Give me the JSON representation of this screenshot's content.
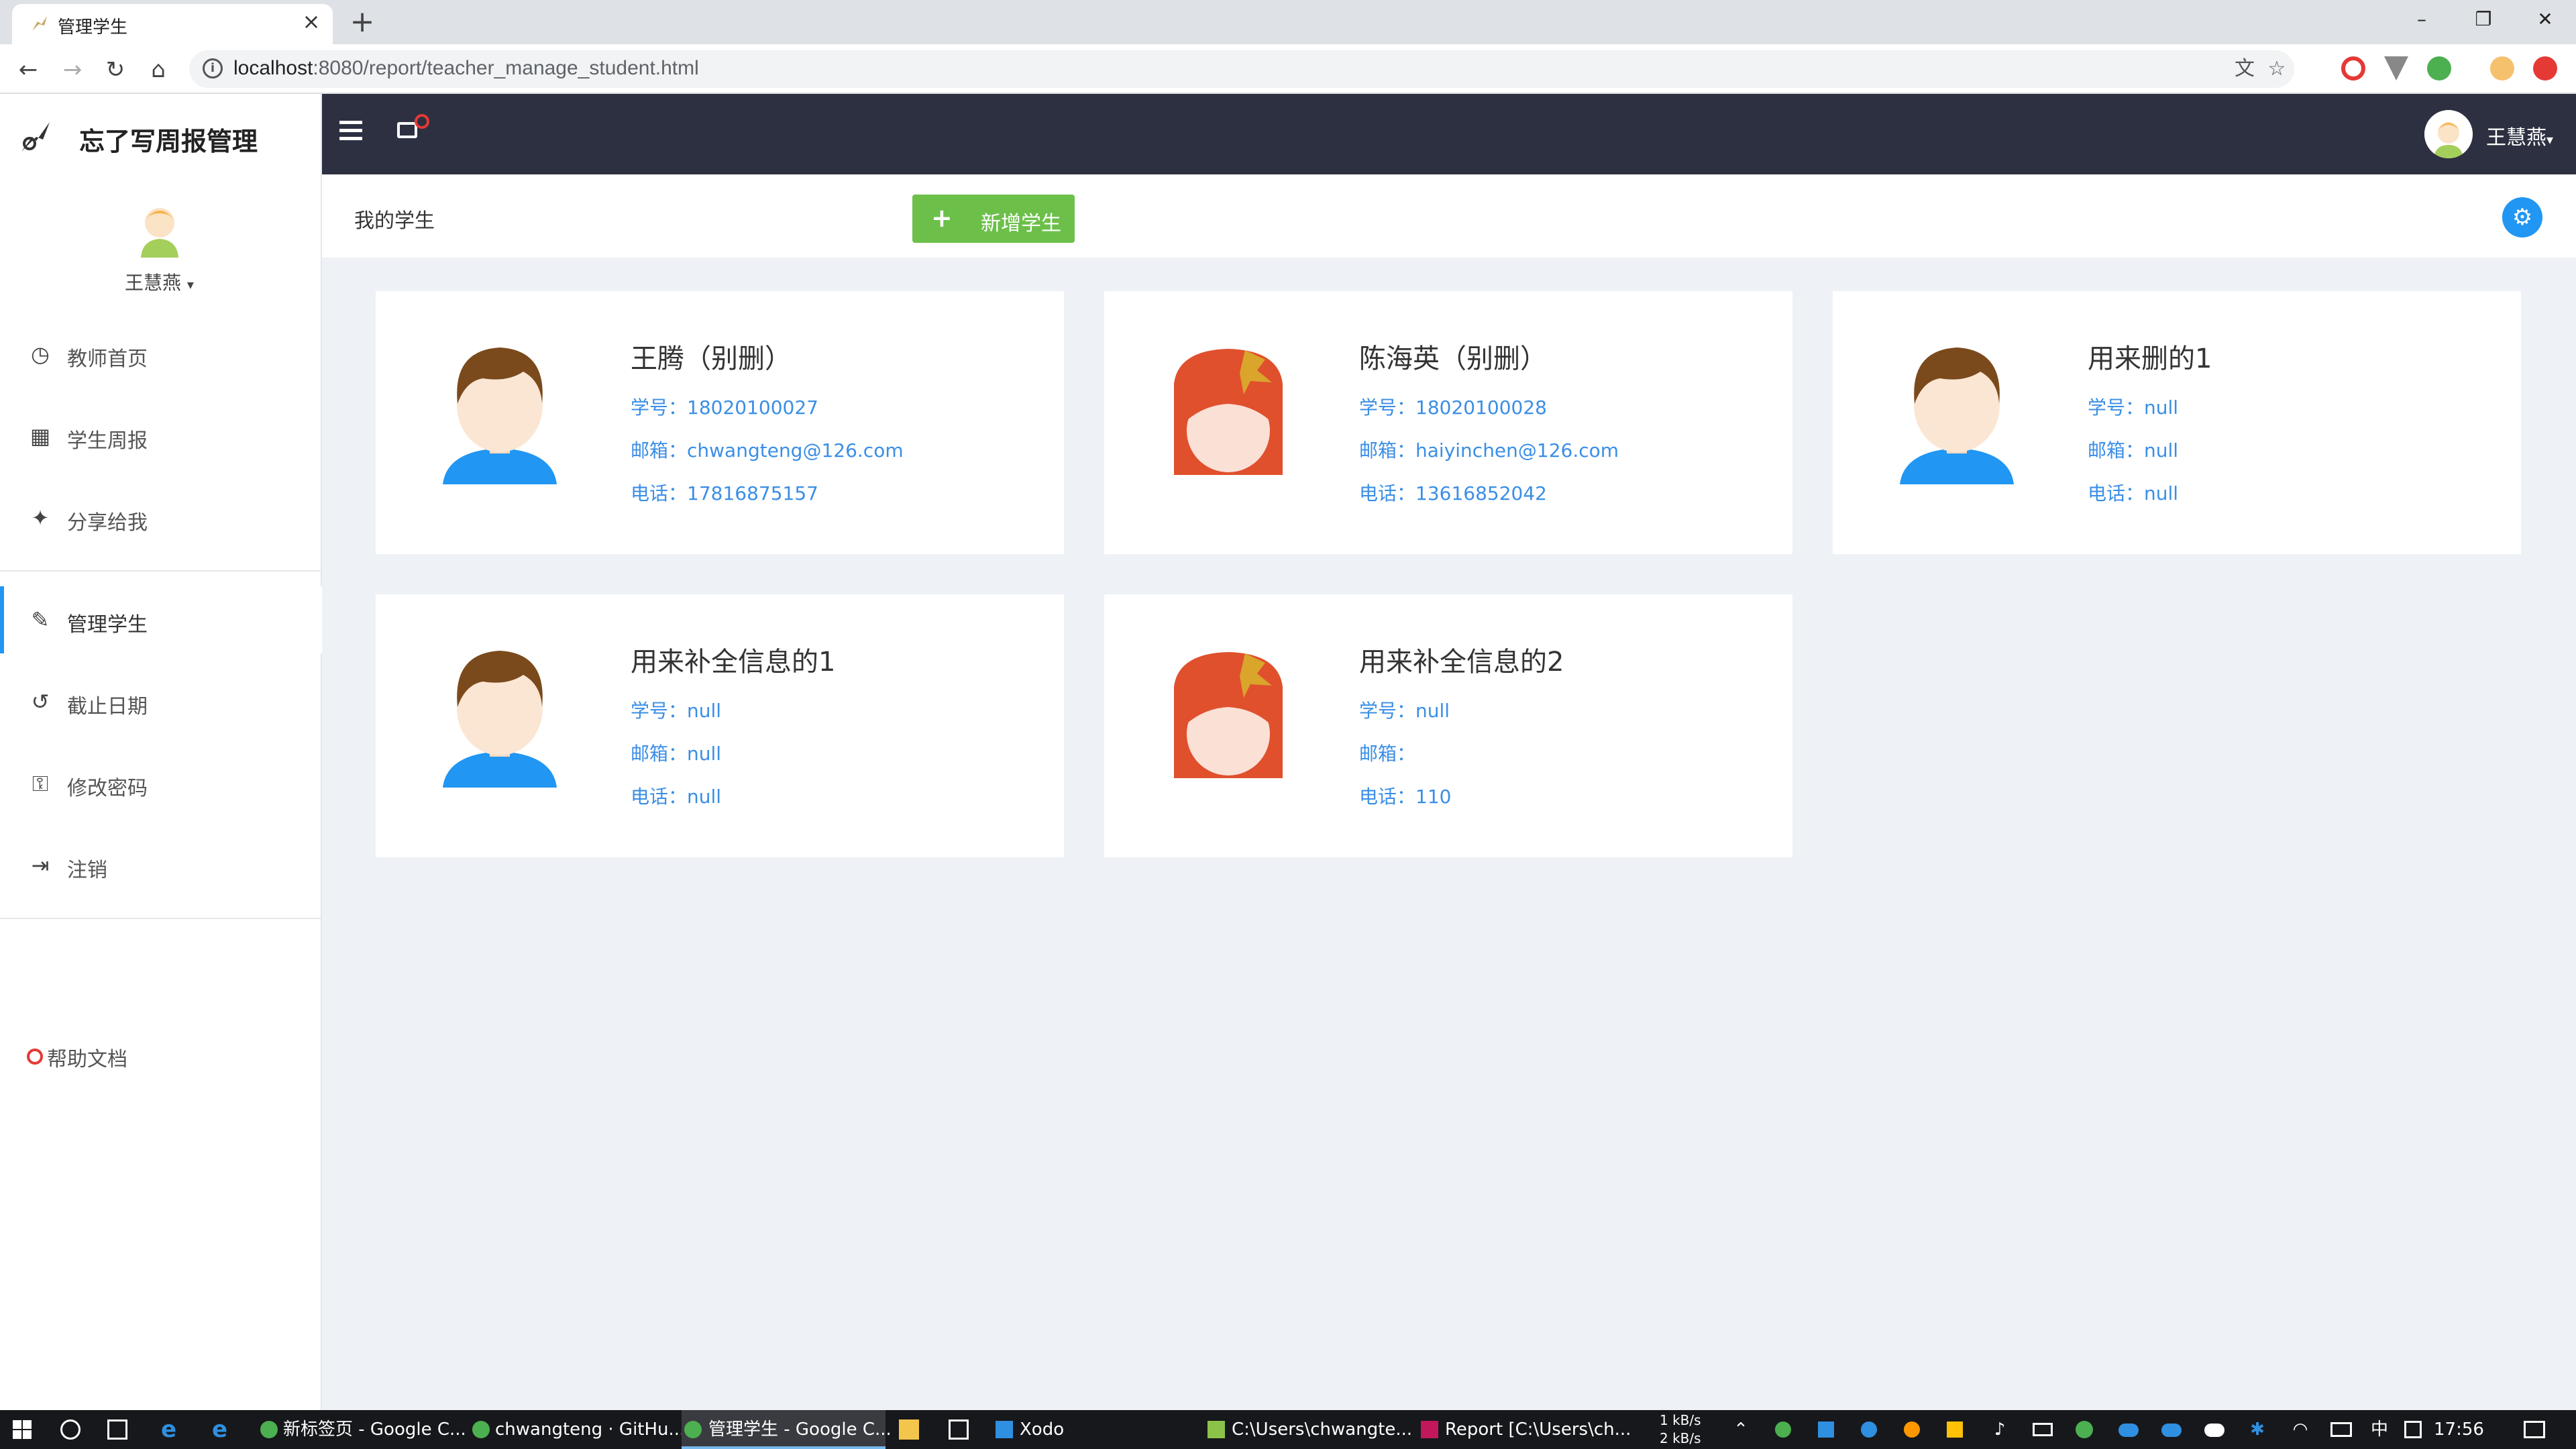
{
  "browser": {
    "tab_title": "管理学生",
    "tab_close": "×",
    "new_tab": "+",
    "url_host": "localhost",
    "url_path": ":8080/report/teacher_manage_student.html",
    "win_min": "–",
    "win_max": "❐",
    "win_close": "✕"
  },
  "app": {
    "brand": "忘了写周报管理",
    "user": "王慧燕",
    "nav": [
      {
        "label": "教师首页",
        "icon": "dashboard-icon",
        "glyph": "◷"
      },
      {
        "label": "学生周报",
        "icon": "calendar-icon",
        "glyph": "▦"
      },
      {
        "label": "分享给我",
        "icon": "sparkle-icon",
        "glyph": "✦"
      },
      {
        "label": "管理学生",
        "icon": "user-edit-icon",
        "glyph": "✎",
        "active": true
      },
      {
        "label": "截止日期",
        "icon": "history-icon",
        "glyph": "↺"
      },
      {
        "label": "修改密码",
        "icon": "key-icon",
        "glyph": "⚿"
      },
      {
        "label": "注销",
        "icon": "logout-icon",
        "glyph": "⇥"
      }
    ],
    "help": "帮助文档",
    "breadcrumb": "我的学生",
    "add_button": "新增学生",
    "accent_color": "#2196f3",
    "add_color": "#6cc04a"
  },
  "students": [
    {
      "name": "王腾（别删）",
      "id_label": "学号：",
      "id": "18020100027",
      "email_label": "邮箱：",
      "email": "chwangteng@126.com",
      "phone_label": "电话：",
      "phone": "17816875157",
      "gender": "male"
    },
    {
      "name": "陈海英（别删）",
      "id_label": "学号：",
      "id": "18020100028",
      "email_label": "邮箱：",
      "email": "haiyinchen@126.com",
      "phone_label": "电话：",
      "phone": "13616852042",
      "gender": "female"
    },
    {
      "name": "用来删的1",
      "id_label": "学号：",
      "id": "null",
      "email_label": "邮箱：",
      "email": "null",
      "phone_label": "电话：",
      "phone": "null",
      "gender": "male"
    },
    {
      "name": "用来补全信息的1",
      "id_label": "学号：",
      "id": "null",
      "email_label": "邮箱：",
      "email": "null",
      "phone_label": "电话：",
      "phone": "null",
      "gender": "male"
    },
    {
      "name": "用来补全信息的2",
      "id_label": "学号：",
      "id": "null",
      "email_label": "邮箱：",
      "email": "",
      "phone_label": "电话：",
      "phone": "110",
      "gender": "female"
    }
  ],
  "taskbar": {
    "items": [
      "新标签页 - Google C...",
      "chwangteng · GitHu...",
      "管理学生 - Google C...",
      "Xodo",
      "C:\\Users\\chwangte...",
      "Report [C:\\Users\\ch..."
    ],
    "net_up": "1 kB/s",
    "net_down": "2 kB/s",
    "ime": "中",
    "time": "17:56"
  }
}
